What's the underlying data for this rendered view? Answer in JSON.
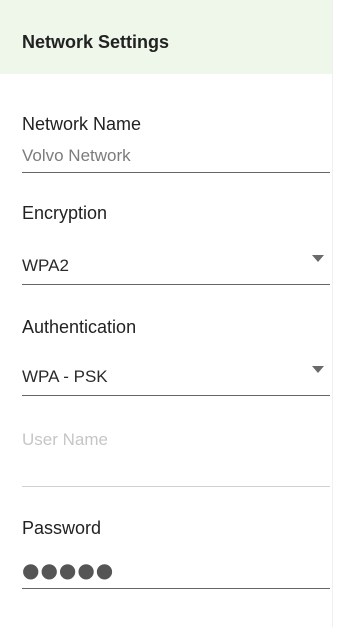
{
  "header": {
    "title": "Network Settings"
  },
  "fields": {
    "network_name": {
      "label": "Network Name",
      "value": "Volvo Network"
    },
    "encryption": {
      "label": "Encryption",
      "value": "WPA2",
      "icon": "chevron-down-icon"
    },
    "authentication": {
      "label": "Authentication",
      "value": "WPA - PSK",
      "icon": "chevron-down-icon"
    },
    "user_name": {
      "placeholder": "User Name"
    },
    "password": {
      "label": "Password",
      "masked_value": "●●●●●"
    }
  },
  "colors": {
    "header_bg": "#eef7ea",
    "underline": "#666666",
    "placeholder": "#c6c6c6"
  }
}
